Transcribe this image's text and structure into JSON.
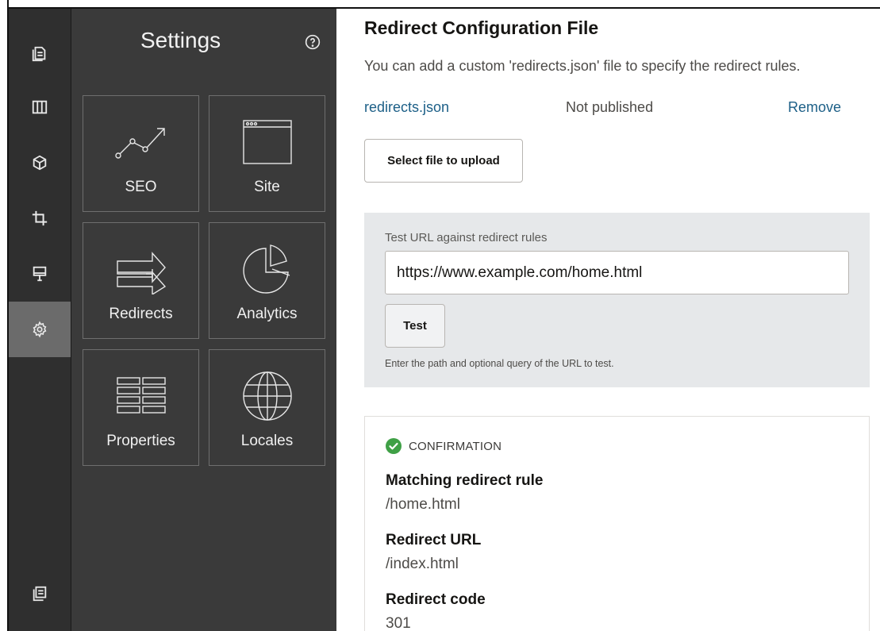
{
  "rail": {
    "items": [
      {
        "icon": "pages-icon"
      },
      {
        "icon": "layout-columns-icon"
      },
      {
        "icon": "components-cube-icon"
      },
      {
        "icon": "crop-icon"
      },
      {
        "icon": "theme-brush-icon"
      },
      {
        "icon": "settings-gear-icon",
        "active": true
      },
      {
        "icon": "publish-pages-icon"
      }
    ]
  },
  "panel": {
    "title": "Settings",
    "help_icon": "help-circle-icon",
    "tiles": [
      {
        "label": "SEO",
        "icon": "seo-trend-icon"
      },
      {
        "label": "Site",
        "icon": "browser-window-icon"
      },
      {
        "label": "Redirects",
        "icon": "redirect-arrows-icon"
      },
      {
        "label": "Analytics",
        "icon": "pie-chart-icon"
      },
      {
        "label": "Properties",
        "icon": "properties-grid-icon"
      },
      {
        "label": "Locales",
        "icon": "globe-icon"
      }
    ]
  },
  "main": {
    "title": "Redirect Configuration File",
    "description": "You can add a custom 'redirects.json' file to specify the redirect rules.",
    "file": {
      "name": "redirects.json",
      "status": "Not published",
      "remove_label": "Remove"
    },
    "upload_label": "Select file to upload",
    "test": {
      "label": "Test URL against redirect rules",
      "input_value": "https://www.example.com/home.html",
      "button_label": "Test",
      "help_text": "Enter the path and optional query of the URL to test."
    },
    "result": {
      "status": "CONFIRMATION",
      "status_color": "#3fa046",
      "fields": [
        {
          "label": "Matching redirect rule",
          "value": "/home.html"
        },
        {
          "label": "Redirect URL",
          "value": "/index.html"
        },
        {
          "label": "Redirect code",
          "value": "301"
        }
      ]
    }
  }
}
